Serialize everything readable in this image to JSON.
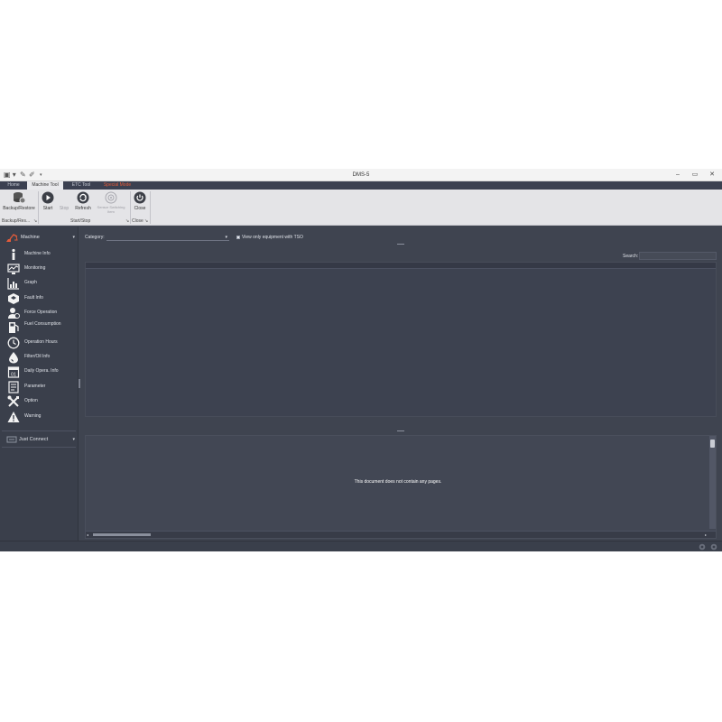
{
  "window": {
    "title": "DMS-5",
    "minimize": "–",
    "maximize": "▭",
    "close": "✕",
    "quick_access": [
      "▣ ▾",
      "✎",
      "✐",
      "▾"
    ]
  },
  "tabs": [
    {
      "label": "Home",
      "active": false
    },
    {
      "label": "Machine Tool",
      "active": true
    },
    {
      "label": "ETC Tool",
      "active": false
    },
    {
      "label": "Special Mode",
      "active": false
    }
  ],
  "ribbon": {
    "backup_restore": "Backup/Restore",
    "start": "Start",
    "stop": "Stop",
    "refresh": "Refresh",
    "sensor_switching": "Sensor Switching Item",
    "close": "Close",
    "groups": {
      "backup": "Backup/Res...",
      "startstop": "Start/Stop",
      "close": "Close"
    },
    "launcher": "↘"
  },
  "sidebar": {
    "header": "Machine",
    "header_chevron": "▾",
    "items": [
      {
        "label": "Machine Info",
        "icon": "info-icon"
      },
      {
        "label": "Monitoring",
        "icon": "monitoring-icon"
      },
      {
        "label": "Graph",
        "icon": "graph-icon"
      },
      {
        "label": "Fault Info",
        "icon": "fault-icon"
      },
      {
        "label": "Force Operation",
        "icon": "force-operation-icon"
      },
      {
        "label": "Fuel Consumption",
        "icon": "fuel-pump-icon"
      },
      {
        "label": "Operation Hours",
        "icon": "clock-icon"
      },
      {
        "label": "Filter/Oil Info",
        "icon": "oil-drop-icon"
      },
      {
        "label": "Daily Opera. Info",
        "icon": "calendar-icon"
      },
      {
        "label": "Parameter",
        "icon": "parameter-icon"
      },
      {
        "label": "Option",
        "icon": "tools-icon"
      },
      {
        "label": "Warning",
        "icon": "warning-icon"
      }
    ],
    "just_connect": "Just Connect",
    "just_connect_chevron": "▾"
  },
  "main": {
    "category_label": "Category:",
    "category_value": "",
    "category_arrow": "▾",
    "tso_label": "View only equipment with TSO",
    "search_label": "Search:",
    "search_value": "",
    "doc_message": "This document does not contain any pages.",
    "scroll_left": "◂",
    "scroll_right": "▸"
  },
  "colors": {
    "app_bg": "#3f4450",
    "ribbon_bg": "#e4e4e7",
    "special_tab": "#e25b3a"
  }
}
